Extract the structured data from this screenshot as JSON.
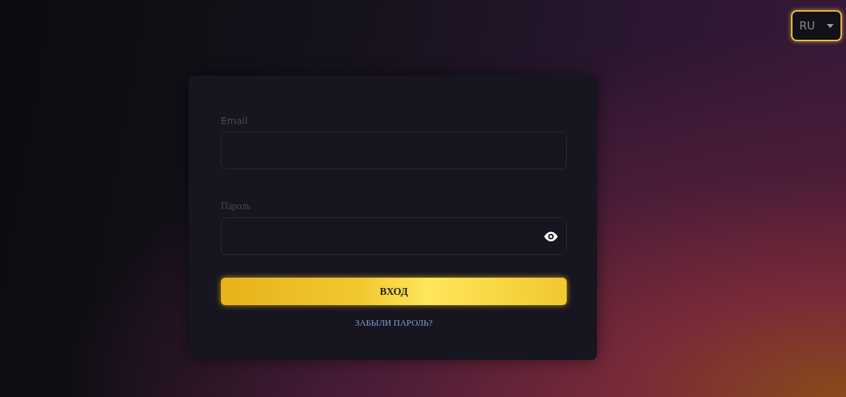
{
  "language_select": {
    "value": "RU"
  },
  "login_form": {
    "email": {
      "label": "Email"
    },
    "password": {
      "label": "Пароль"
    },
    "submit": "ВХОД",
    "forgot_link": "ЗАБЫЛИ ПАРОЛЬ?"
  }
}
